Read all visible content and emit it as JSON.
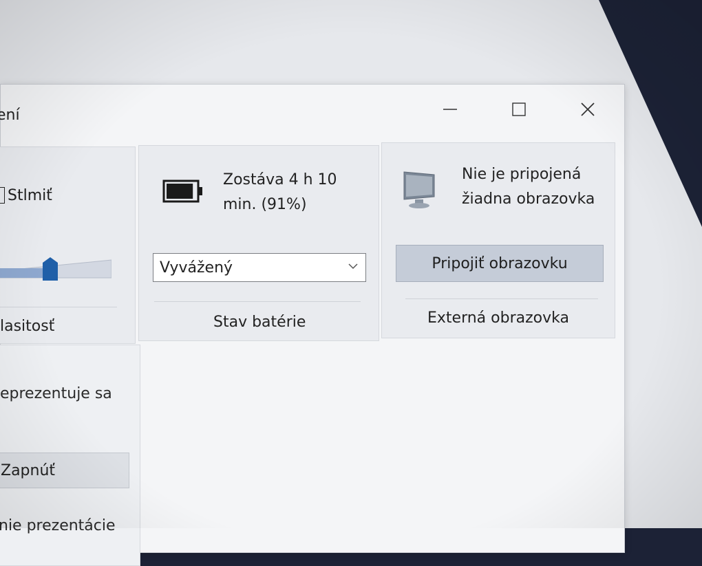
{
  "window": {
    "title_fragment": "ení",
    "controls": {
      "minimize_icon": "minimize-icon",
      "maximize_icon": "maximize-icon",
      "close_icon": "close-icon"
    }
  },
  "volume_tile": {
    "mute_label": "Stlmiť",
    "caption": "lasitosť",
    "volume_level": 0.45,
    "slider_handle_icon": "slider-handle"
  },
  "battery_tile": {
    "battery_icon": "battery-icon",
    "status_line1": "Zostáva 4 h 10",
    "status_line2": "min. (91%)",
    "battery_percent": 91,
    "power_plan_value": "Vyvážený",
    "caption": "Stav batérie"
  },
  "display_tile": {
    "monitor_icon": "monitor-icon",
    "status_line1": "Nie je pripojená",
    "status_line2": "žiadna obrazovka",
    "connect_button": "Pripojiť obrazovku",
    "caption": "Externá obrazovka"
  },
  "presentation_tile": {
    "status_text": "eprezentuje sa",
    "toggle_button": "Zapnúť",
    "bottom_text": "nie prezentácie"
  },
  "colors": {
    "accent": "#1f5fa8",
    "tile_bg": "#e9ebef",
    "button_bg": "#c5ccd8"
  }
}
